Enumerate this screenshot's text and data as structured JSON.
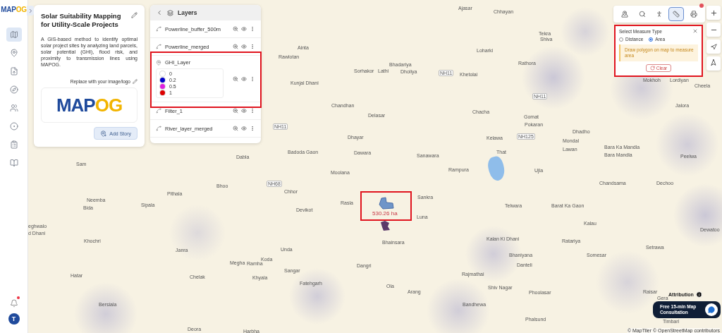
{
  "app": {
    "logo": [
      "MAP",
      "OG"
    ]
  },
  "sidebar": {
    "items": [
      {
        "selected": true
      },
      {
        "selected": false
      },
      {
        "selected": false
      },
      {
        "selected": false
      },
      {
        "selected": false
      },
      {
        "selected": false
      },
      {
        "selected": false
      },
      {
        "selected": false
      }
    ]
  },
  "notifications": {
    "unread": true
  },
  "user": {
    "initial": "T"
  },
  "story": {
    "title": "Solar Suitability Mapping for Utility-Scale Projects",
    "description": "A GIS-based method to identify optimal solar project sites by analyzing land parcels, solar potential (GHI), flood risk, and proximity to transmission lines using MAPOG.",
    "replace_label": "Replace with your image/logo",
    "logo": [
      "MAP",
      "OG"
    ],
    "button": "Add Story"
  },
  "layers": {
    "title": "Layers",
    "items": [
      {
        "name": "Powerline_buffer_500m",
        "kind": "vector"
      },
      {
        "name": "Powerline_merged",
        "kind": "vector"
      },
      {
        "name": "GHI_Layer",
        "kind": "raster",
        "legend": [
          {
            "label": "0",
            "color": "#ffffff"
          },
          {
            "label": "0.2",
            "color": "#0000cc"
          },
          {
            "label": "0.5",
            "color": "#e020e0"
          },
          {
            "label": "1",
            "color": "#dd0000"
          }
        ]
      },
      {
        "name": "Filter_1",
        "kind": "vector"
      },
      {
        "name": "River_layer_merged",
        "kind": "vector"
      }
    ]
  },
  "toolbar": {
    "tools": [
      {
        "selected": false
      },
      {
        "selected": false
      },
      {
        "selected": false
      },
      {
        "selected": true
      },
      {
        "selected": false
      }
    ],
    "alert": true
  },
  "measure": {
    "title": "Select Measure Type",
    "options": [
      {
        "label": "Distance",
        "selected": false
      },
      {
        "label": "Area",
        "selected": true
      }
    ],
    "hint": "Draw polygon on map to measure area",
    "button": "Clear"
  },
  "measurement": {
    "reading": "530.26 ha"
  },
  "map": {
    "places": [
      {
        "name": "Ajasar",
        "kind": "town"
      },
      {
        "name": "Chhayan",
        "kind": "town"
      },
      {
        "name": "Tekra",
        "kind": "town"
      },
      {
        "name": "Shiva",
        "kind": "town"
      },
      {
        "name": "Ainta",
        "kind": "town"
      },
      {
        "name": "Rawlotan",
        "kind": "town"
      },
      {
        "name": "Loharki",
        "kind": "town"
      },
      {
        "name": "Rathora",
        "kind": "town"
      },
      {
        "name": "Bhadariya",
        "kind": "town"
      },
      {
        "name": "Sorhakor",
        "kind": "town"
      },
      {
        "name": "Lathi",
        "kind": "town"
      },
      {
        "name": "Dholiya",
        "kind": "town"
      },
      {
        "name": "NH11",
        "kind": "road"
      },
      {
        "name": "Khetolai",
        "kind": "town"
      },
      {
        "name": "NH11",
        "kind": "road"
      },
      {
        "name": "Kunjal Dhani",
        "kind": "town"
      },
      {
        "name": "Mokhoh",
        "kind": "town"
      },
      {
        "name": "Lordiyan",
        "kind": "town"
      },
      {
        "name": "Cheela",
        "kind": "town"
      },
      {
        "name": "Jalora",
        "kind": "town"
      },
      {
        "name": "Chandhan",
        "kind": "town"
      },
      {
        "name": "NH11",
        "kind": "road"
      },
      {
        "name": "Delasar",
        "kind": "town"
      },
      {
        "name": "Chacha",
        "kind": "town"
      },
      {
        "name": "Gomat",
        "kind": "town"
      },
      {
        "name": "Pokaran",
        "kind": "town"
      },
      {
        "name": "Dhayar",
        "kind": "town"
      },
      {
        "name": "Kelawa",
        "kind": "town"
      },
      {
        "name": "NH125",
        "kind": "road"
      },
      {
        "name": "Dhadho",
        "kind": "town"
      },
      {
        "name": "Mondal",
        "kind": "town"
      },
      {
        "name": "Lawan",
        "kind": "town"
      },
      {
        "name": "Bara Ka Mandla",
        "kind": "town"
      },
      {
        "name": "Dabla",
        "kind": "town"
      },
      {
        "name": "Badoda Gaon",
        "kind": "town"
      },
      {
        "name": "Dawara",
        "kind": "town"
      },
      {
        "name": "Sanawara",
        "kind": "town"
      },
      {
        "name": "That",
        "kind": "town"
      },
      {
        "name": "Bara Mandla",
        "kind": "town"
      },
      {
        "name": "Peelwa",
        "kind": "town"
      },
      {
        "name": "Sam",
        "kind": "town"
      },
      {
        "name": "Moolana",
        "kind": "town"
      },
      {
        "name": "Rampura",
        "kind": "town"
      },
      {
        "name": "Ujla",
        "kind": "town"
      },
      {
        "name": "Chandsama",
        "kind": "town"
      },
      {
        "name": "Dechoo",
        "kind": "town"
      },
      {
        "name": "Bhoo",
        "kind": "town"
      },
      {
        "name": "NH68",
        "kind": "road"
      },
      {
        "name": "Chhor",
        "kind": "town"
      },
      {
        "name": "Pithala",
        "kind": "town"
      },
      {
        "name": "Rasla",
        "kind": "town"
      },
      {
        "name": "Sankra",
        "kind": "town"
      },
      {
        "name": "Telwara",
        "kind": "town"
      },
      {
        "name": "Barat Ka Gaon",
        "kind": "town"
      },
      {
        "name": "Neemba",
        "kind": "town"
      },
      {
        "name": "Bida",
        "kind": "town"
      },
      {
        "name": "Sipala",
        "kind": "town"
      },
      {
        "name": "Devikot",
        "kind": "town"
      },
      {
        "name": "Luna",
        "kind": "town"
      },
      {
        "name": "Kalau",
        "kind": "town"
      },
      {
        "name": "Dewatoo",
        "kind": "town"
      },
      {
        "name": "eghwalo",
        "kind": "town"
      },
      {
        "name": "d Dhani",
        "kind": "town"
      },
      {
        "name": "Khochri",
        "kind": "town"
      },
      {
        "name": "Bhainsara",
        "kind": "town"
      },
      {
        "name": "Kalan Ki Dhani",
        "kind": "town"
      },
      {
        "name": "Ratariya",
        "kind": "town"
      },
      {
        "name": "Bhaniyana",
        "kind": "town"
      },
      {
        "name": "Setrawa",
        "kind": "town"
      },
      {
        "name": "Janra",
        "kind": "town"
      },
      {
        "name": "Unda",
        "kind": "town"
      },
      {
        "name": "Somesar",
        "kind": "town"
      },
      {
        "name": "Megha",
        "kind": "town"
      },
      {
        "name": "Ramha",
        "kind": "town"
      },
      {
        "name": "Koda",
        "kind": "town"
      },
      {
        "name": "Dangri",
        "kind": "town"
      },
      {
        "name": "Danteli",
        "kind": "town"
      },
      {
        "name": "Sangar",
        "kind": "town"
      },
      {
        "name": "Hatar",
        "kind": "town"
      },
      {
        "name": "Chelak",
        "kind": "town"
      },
      {
        "name": "Khyala",
        "kind": "town"
      },
      {
        "name": "Rajmathai",
        "kind": "town"
      },
      {
        "name": "Fatehgarh",
        "kind": "town"
      },
      {
        "name": "Ola",
        "kind": "town"
      },
      {
        "name": "Arang",
        "kind": "town"
      },
      {
        "name": "Shiv Nagar",
        "kind": "town"
      },
      {
        "name": "Phoolasar",
        "kind": "town"
      },
      {
        "name": "Raisar",
        "kind": "town"
      },
      {
        "name": "Gera",
        "kind": "town"
      },
      {
        "name": "Bersiala",
        "kind": "town"
      },
      {
        "name": "Bandhewa",
        "kind": "town"
      },
      {
        "name": "Phalsund",
        "kind": "town"
      },
      {
        "name": "Timbari",
        "kind": "town"
      },
      {
        "name": "Deora",
        "kind": "town"
      },
      {
        "name": "Harbha",
        "kind": "town"
      }
    ]
  },
  "attribution": {
    "label": "Attribution",
    "credits": "© MapTiler © OpenStreetMap contributors"
  },
  "consultation": {
    "label": "Free 15-min Map Consultation"
  }
}
